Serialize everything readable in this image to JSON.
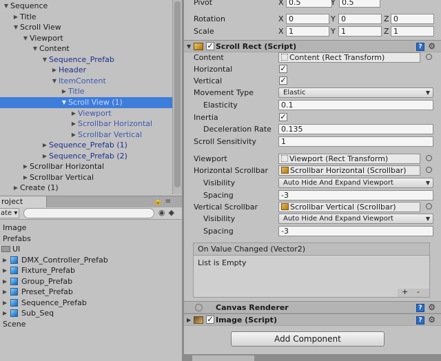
{
  "hierarchy": {
    "items": [
      {
        "label": "Sequence",
        "indent": 0,
        "arrow": "▼",
        "style": "normal"
      },
      {
        "label": "Title",
        "indent": 1,
        "arrow": "▶",
        "style": "normal"
      },
      {
        "label": "Scroll View",
        "indent": 1,
        "arrow": "▼",
        "style": "normal"
      },
      {
        "label": "Viewport",
        "indent": 2,
        "arrow": "▼",
        "style": "normal"
      },
      {
        "label": "Content",
        "indent": 3,
        "arrow": "▼",
        "style": "normal"
      },
      {
        "label": "Sequence_Prefab",
        "indent": 4,
        "arrow": "▼",
        "style": "prefab"
      },
      {
        "label": "Header",
        "indent": 5,
        "arrow": "▶",
        "style": "prefab"
      },
      {
        "label": "ItemContent",
        "indent": 5,
        "arrow": "▼",
        "style": "prefab-light"
      },
      {
        "label": "Title",
        "indent": 6,
        "arrow": "▶",
        "style": "prefab-light"
      },
      {
        "label": "Scroll View (1)",
        "indent": 6,
        "arrow": "▼",
        "style": "sel"
      },
      {
        "label": "Viewport",
        "indent": 7,
        "arrow": "▶",
        "style": "prefab-light"
      },
      {
        "label": "Scrollbar Horizontal",
        "indent": 7,
        "arrow": "▶",
        "style": "prefab-light"
      },
      {
        "label": "Scrollbar Vertical",
        "indent": 7,
        "arrow": "▶",
        "style": "prefab-light"
      },
      {
        "label": "Sequence_Prefab (1)",
        "indent": 4,
        "arrow": "▶",
        "style": "prefab"
      },
      {
        "label": "Sequence_Prefab (2)",
        "indent": 4,
        "arrow": "▶",
        "style": "prefab"
      },
      {
        "label": "Scrollbar Horizontal",
        "indent": 2,
        "arrow": "▶",
        "style": "normal"
      },
      {
        "label": "Scrollbar Vertical",
        "indent": 2,
        "arrow": "▶",
        "style": "normal"
      },
      {
        "label": "Create (1)",
        "indent": 1,
        "arrow": "▶",
        "style": "normal"
      }
    ]
  },
  "project": {
    "tab_label": "roject",
    "create_label": "ate ▾",
    "items": [
      {
        "label": "Image",
        "type": "plain",
        "arrow": ""
      },
      {
        "label": "Prefabs",
        "type": "plain",
        "arrow": ""
      },
      {
        "label": "UI",
        "type": "folder",
        "arrow": ""
      },
      {
        "label": "DMX_Controller_Prefab",
        "type": "prefab",
        "arrow": "▶"
      },
      {
        "label": "Fixture_Prefab",
        "type": "prefab",
        "arrow": "▶"
      },
      {
        "label": "Group_Prefab",
        "type": "prefab",
        "arrow": "▶"
      },
      {
        "label": "Preset_Prefab",
        "type": "prefab",
        "arrow": "▶"
      },
      {
        "label": "Sequence_Prefab",
        "type": "prefab",
        "arrow": "▶"
      },
      {
        "label": "Sub_Seq",
        "type": "prefab",
        "arrow": "▶"
      },
      {
        "label": "Scene",
        "type": "plain",
        "arrow": ""
      }
    ]
  },
  "inspector": {
    "pivot": {
      "label": "Pivot",
      "x": "0.5",
      "y": "0.5"
    },
    "rotation": {
      "label": "Rotation",
      "x": "0",
      "y": "0",
      "z": "0"
    },
    "scale": {
      "label": "Scale",
      "x": "1",
      "y": "1",
      "z": "1"
    },
    "axis_x": "X",
    "axis_y": "Y",
    "axis_z": "Z",
    "scroll_rect": {
      "title": "Scroll Rect (Script)",
      "content_label": "Content",
      "content_value": "Content (Rect Transform)",
      "horizontal_label": "Horizontal",
      "horizontal_checked": true,
      "vertical_label": "Vertical",
      "vertical_checked": true,
      "movement_label": "Movement Type",
      "movement_value": "Elastic",
      "elasticity_label": "Elasticity",
      "elasticity_value": "0.1",
      "inertia_label": "Inertia",
      "inertia_checked": true,
      "decel_label": "Deceleration Rate",
      "decel_value": "0.135",
      "sensitivity_label": "Scroll Sensitivity",
      "sensitivity_value": "1",
      "viewport_label": "Viewport",
      "viewport_value": "Viewport (Rect Transform)",
      "hscroll_label": "Horizontal Scrollbar",
      "hscroll_value": "Scrollbar Horizontal (Scrollbar)",
      "hvis_label": "Visibility",
      "hvis_value": "Auto Hide And Expand Viewport",
      "hspacing_label": "Spacing",
      "hspacing_value": "-3",
      "vscroll_label": "Vertical Scrollbar",
      "vscroll_value": "Scrollbar Vertical (Scrollbar)",
      "vvis_label": "Visibility",
      "vvis_value": "Auto Hide And Expand Viewport",
      "vspacing_label": "Spacing",
      "vspacing_value": "-3",
      "event_title": "On Value Changed (Vector2)",
      "event_body": "List is Empty",
      "event_add": "+",
      "event_remove": "-"
    },
    "canvas_renderer_title": "Canvas Renderer",
    "image_title": "Image (Script)",
    "add_component_label": "Add Component",
    "help_glyph": "?",
    "gear_glyph": "⚙"
  },
  "colors": {
    "selection": "#3d7ddb",
    "prefab_text": "#1c2f8f",
    "panel_bg": "#c2c2c2"
  }
}
